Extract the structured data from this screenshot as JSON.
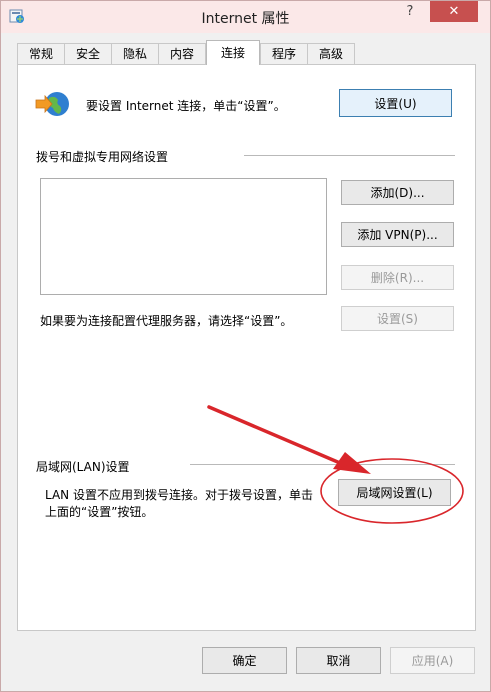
{
  "window": {
    "title": "Internet 属性",
    "help_label": "?",
    "close_label": "✕"
  },
  "tabs": [
    {
      "label": "常规"
    },
    {
      "label": "安全"
    },
    {
      "label": "隐私"
    },
    {
      "label": "内容"
    },
    {
      "label": "连接",
      "active": true
    },
    {
      "label": "程序"
    },
    {
      "label": "高级"
    }
  ],
  "connection": {
    "setup_text": "要设置 Internet 连接，单击“设置”。",
    "setup_button": "设置(U)"
  },
  "dialup": {
    "section_label": "拨号和虚拟专用网络设置",
    "add_button": "添加(D)...",
    "add_vpn_button": "添加 VPN(P)...",
    "delete_button": "删除(R)...",
    "proxy_text": "如果要为连接配置代理服务器，请选择“设置”。",
    "settings_button": "设置(S)"
  },
  "lan": {
    "section_label": "局域网(LAN)设置",
    "info_line1": "LAN 设置不应用到拨号连接。对于拨号设置，单击",
    "info_line2": "上面的“设置”按钮。",
    "lan_button": "局域网设置(L)"
  },
  "footer": {
    "ok_button": "确定",
    "cancel_button": "取消",
    "apply_button": "应用(A)"
  },
  "colors": {
    "annotation_red": "#d9262b",
    "close_button": "#c7504f"
  }
}
